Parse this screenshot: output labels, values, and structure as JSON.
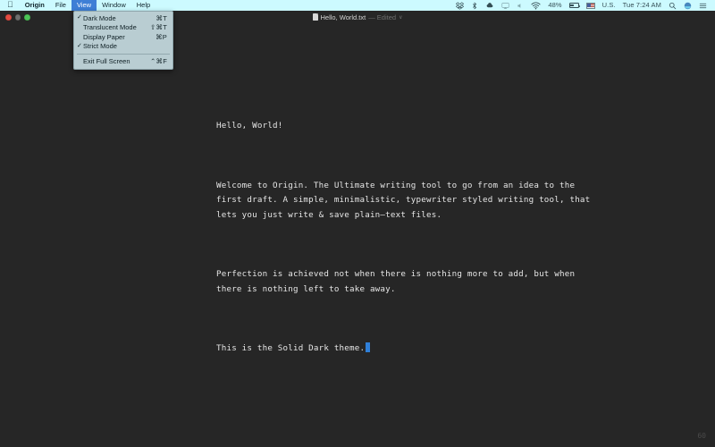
{
  "menubar": {
    "apple_icon": "apple-icon",
    "items": [
      {
        "label": "Origin",
        "bold": true,
        "active": false
      },
      {
        "label": "File",
        "bold": false,
        "active": false
      },
      {
        "label": "View",
        "bold": false,
        "active": true
      },
      {
        "label": "Window",
        "bold": false,
        "active": false
      },
      {
        "label": "Help",
        "bold": false,
        "active": false
      }
    ],
    "status": {
      "dropbox_icon": "dropbox-icon",
      "bluetooth_icon": "bluetooth-icon",
      "cloud_icon": "cloud-icon",
      "airplay_icon": "airplay-icon",
      "volume_icon": "volume-icon",
      "wifi_icon": "wifi-icon",
      "battery_percent": "48%",
      "battery_icon": "battery-icon",
      "flag_icon": "us-flag-icon",
      "input_source": "U.S.",
      "clock": "Tue 7:24 AM",
      "search_icon": "search-icon",
      "siri_icon": "siri-icon",
      "controlcenter_icon": "control-center-icon"
    }
  },
  "viewmenu": {
    "items": [
      {
        "checked": "✓",
        "label": "Dark Mode",
        "shortcut": "⌘T"
      },
      {
        "checked": "",
        "label": "Translucent Mode",
        "shortcut": "⇧⌘T"
      },
      {
        "checked": "",
        "label": "Display Paper",
        "shortcut": "⌘P"
      },
      {
        "checked": "✓",
        "label": "Strict Mode",
        "shortcut": ""
      }
    ],
    "footer": {
      "checked": "",
      "label": "Exit Full Screen",
      "shortcut": "⌃⌘F"
    }
  },
  "window": {
    "traffic": {
      "close": "close-button",
      "minimize": "minimize-button",
      "zoom": "zoom-button"
    },
    "title": "Hello, World.txt",
    "edited": "— Edited",
    "chevron": "∨",
    "doc_icon": "document-icon"
  },
  "document": {
    "paragraphs": [
      "Hello, World!",
      "Welcome to Origin. The Ultimate writing tool to go from an idea to the\nfirst draft. A simple, minimalistic, typewriter styled writing tool, that\nlets you just write & save plain—text files.",
      "Perfection is achieved not when there is nothing more to add, but when\nthere is nothing left to take away."
    ],
    "last_line": "This is the Solid Dark theme.",
    "counter": "60"
  },
  "colors": {
    "menubar_bg": "#ccfaff",
    "menu_highlight": "#3e7fd6",
    "dropdown_bg": "#b9cdd2",
    "editor_bg": "#262626",
    "editor_text": "#e6e6e6",
    "cursor": "#2f7fd8",
    "traffic_close": "#e24b41",
    "traffic_min": "#6e6e6e",
    "traffic_zoom": "#4cc456"
  }
}
